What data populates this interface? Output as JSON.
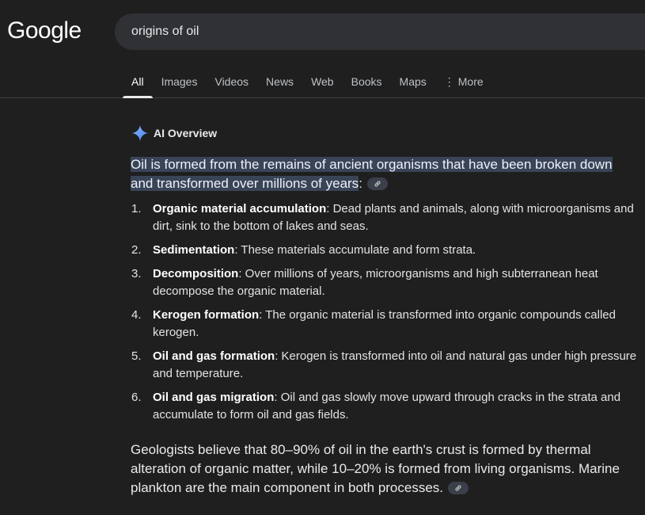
{
  "logo": "Google",
  "search": {
    "query": "origins of oil"
  },
  "tabs": [
    {
      "label": "All",
      "active": true
    },
    {
      "label": "Images",
      "active": false
    },
    {
      "label": "Videos",
      "active": false
    },
    {
      "label": "News",
      "active": false
    },
    {
      "label": "Web",
      "active": false
    },
    {
      "label": "Books",
      "active": false
    },
    {
      "label": "Maps",
      "active": false
    },
    {
      "label": "More",
      "active": false
    }
  ],
  "ai_overview": {
    "title": "AI Overview",
    "icon": "sparkle-icon",
    "summary_highlight": "Oil is formed from the remains of ancient organisms that have been broken down and transformed over millions of years",
    "summary_suffix": ":",
    "steps": [
      {
        "number": "1.",
        "title": "Organic material accumulation",
        "text": ": Dead plants and animals, along with microorganisms and dirt, sink to the bottom of lakes and seas."
      },
      {
        "number": "2.",
        "title": "Sedimentation",
        "text": ": These materials accumulate and form strata."
      },
      {
        "number": "3.",
        "title": "Decomposition",
        "text": ": Over millions of years, microorganisms and high subterranean heat decompose the organic material."
      },
      {
        "number": "4.",
        "title": "Kerogen formation",
        "text": ": The organic material is transformed into organic compounds called kerogen."
      },
      {
        "number": "5.",
        "title": "Oil and gas formation",
        "text": ": Kerogen is transformed into oil and natural gas under high pressure and temperature."
      },
      {
        "number": "6.",
        "title": "Oil and gas migration",
        "text": ": Oil and gas slowly move upward through cracks in the strata and accumulate to form oil and gas fields."
      }
    ],
    "paragraph": "Geologists believe that 80–90% of oil in the earth's crust is formed by thermal alteration of organic matter, while 10–20% is formed from living organisms. Marine plankton are the main component in both processes."
  },
  "colors": {
    "background": "#1f1f1f",
    "highlight": "#394457",
    "sparkle_blue": "#4285f4"
  }
}
